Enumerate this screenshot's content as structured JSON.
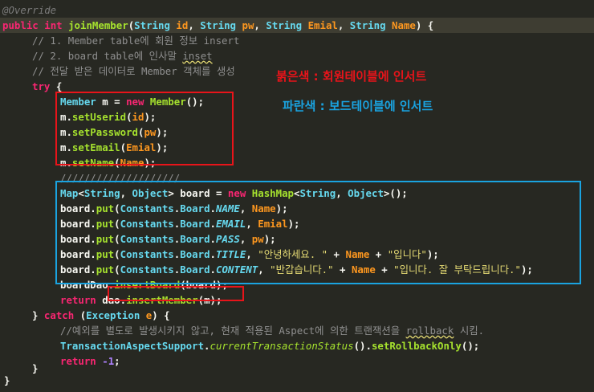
{
  "code": {
    "l1": {
      "annotation": "@Override"
    },
    "l2": {
      "public": "public",
      "int": "int",
      "method": "joinMember",
      "open": "(",
      "t1": "String",
      "p1": "id",
      "c1": ", ",
      "t2": "String",
      "p2": "pw",
      "c2": ", ",
      "t3": "String",
      "p3": "Emial",
      "c3": ", ",
      "t4": "String",
      "p4": "Name",
      "close": ") {"
    },
    "l3": {
      "comment": "// 1. Member table에 회원 정보 insert"
    },
    "l4": {
      "comment": "// 2. board table에 인사말 ",
      "squiggle": "inset"
    },
    "l5": {
      "comment": "// 전달 받은 데이터로 Member 객체를 생성"
    },
    "l6": {
      "try": "try",
      "brace": " {"
    },
    "l7": {
      "type": "Member",
      "var": " m = ",
      "new": "new",
      "ctor": " Member",
      "end": "();"
    },
    "l8": {
      "obj": "m.",
      "call": "setUserid",
      "open": "(",
      "arg": "id",
      "end": ");"
    },
    "l9": {
      "obj": "m.",
      "call": "setPassword",
      "open": "(",
      "arg": "pw",
      "end": ");"
    },
    "l10": {
      "obj": "m.",
      "call": "setEmail",
      "open": "(",
      "arg": "Emial",
      "end": ");"
    },
    "l11": {
      "obj": "m.",
      "call": "setName",
      "open": "(",
      "arg": "Name",
      "end": ");"
    },
    "l12": {
      "comment": "////////////////////"
    },
    "l13": {
      "t1": "Map",
      "lt": "<",
      "t2": "String",
      "cm": ", ",
      "t3": "Object",
      "gt": "> ",
      "var": "board = ",
      "new": "new",
      "ctor": " HashMap",
      "lt2": "<",
      "t4": "String",
      "cm2": ", ",
      "t5": "Object",
      "end": ">();"
    },
    "l14": {
      "obj": "board.",
      "call": "put",
      "open": "(",
      "cls": "Constants",
      "dot1": ".",
      "inner": "Board",
      "dot2": ".",
      "field": "NAME",
      "sep": ", ",
      "arg": "Name",
      "end": ");"
    },
    "l15": {
      "obj": "board.",
      "call": "put",
      "open": "(",
      "cls": "Constants",
      "dot1": ".",
      "inner": "Board",
      "dot2": ".",
      "field": "EMAIL",
      "sep": ", ",
      "arg": "Emial",
      "end": ");"
    },
    "l16": {
      "obj": "board.",
      "call": "put",
      "open": "(",
      "cls": "Constants",
      "dot1": ".",
      "inner": "Board",
      "dot2": ".",
      "field": "PASS",
      "sep": ", ",
      "arg": "pw",
      "end": ");"
    },
    "l17": {
      "obj": "board.",
      "call": "put",
      "open": "(",
      "cls": "Constants",
      "dot1": ".",
      "inner": "Board",
      "dot2": ".",
      "field": "TITLE",
      "sep": ", ",
      "s1": "\"안녕하세요. \"",
      "plus1": " + ",
      "arg": "Name",
      "plus2": " + ",
      "s2": "\"입니다\"",
      "end": ");"
    },
    "l18": {
      "obj": "board.",
      "call": "put",
      "open": "(",
      "cls": "Constants",
      "dot1": ".",
      "inner": "Board",
      "dot2": ".",
      "field": "CONTENT",
      "sep": ", ",
      "s1": "\"반갑습니다.\"",
      "plus1": " + ",
      "arg": "Name",
      "plus2": " + ",
      "s2": "\"입니다. 잘 부탁드립니다.\"",
      "end": ");"
    },
    "l19": {
      "obj": "boardDao.",
      "call": "insertBoard",
      "open": "(",
      "arg": "board",
      "end": ");"
    },
    "l20": {
      "ret": "return",
      "sp": " ",
      "obj": "dao.",
      "call": "insertMember",
      "open": "(",
      "arg": "m",
      "end": ");"
    },
    "l21": {
      "brace": "} ",
      "catch": "catch",
      "open": " (",
      "type": "Exception",
      "var": " e",
      "close": ") {"
    },
    "l22": {
      "comment": "//예외를 별도로 발생시키지 않고, 현재 적용된 Aspect에 의한 트랜잭션을 ",
      "squiggle": "rollback",
      "tail": " 시킴."
    },
    "l23": {
      "cls": "TransactionAspectSupport",
      "dot": ".",
      "m1": "currentTransactionStatus",
      "mid": "().",
      "m2": "setRollbackOnly",
      "end": "();"
    },
    "l24": {
      "ret": "return",
      "sp": " ",
      "num": "-1",
      "end": ";"
    },
    "l25": {
      "brace": "}"
    },
    "l26": {
      "brace": "}"
    }
  },
  "notes": {
    "red": "붉은색 : 회원테이블에 인서트",
    "blue": "파란색 : 보드테이블에 인서트"
  },
  "colors": {
    "background": "#272822",
    "red_box": "#e8141a",
    "blue_box": "#1aa3e0"
  }
}
